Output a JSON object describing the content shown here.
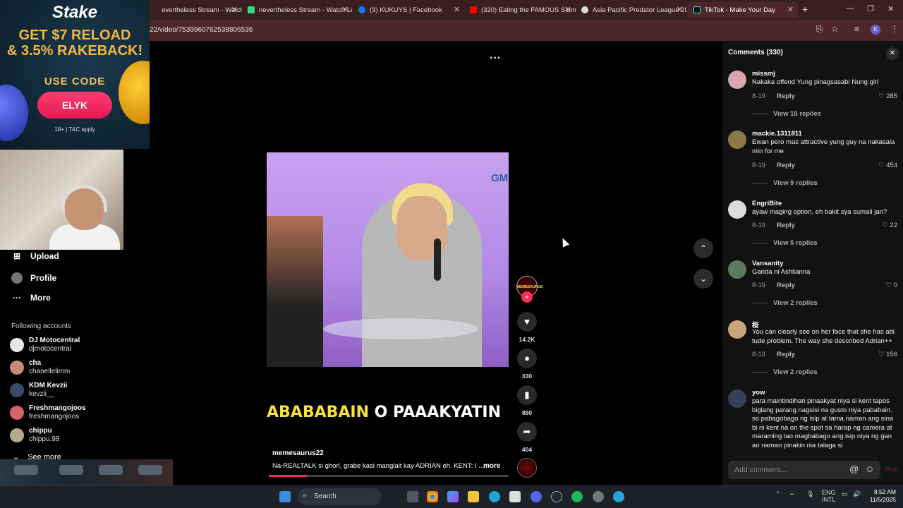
{
  "browser": {
    "tabs": [
      {
        "title": "evertheless Stream - Watch Li",
        "color": "#e53935"
      },
      {
        "title": "nevertheless Stream - Watch Li",
        "color": "#3ddc84"
      },
      {
        "title": "(3) KUKUYS | Facebook",
        "color": "#1877f2"
      },
      {
        "title": "(320) Eating the FAMOUS Slum",
        "color": "#ff0000"
      },
      {
        "title": "Asia Pacific Predator League 20",
        "color": "#ffffff"
      },
      {
        "title": "TikTok - Make Your Day",
        "color": "#000000"
      }
    ],
    "url": "22/video/7539960762538806536"
  },
  "ad": {
    "logo": "Stake",
    "line1": "GET $7 RELOAD",
    "line2": "& 3.5% RAKEBACK!",
    "code_label": "USE CODE",
    "code": "ELYK",
    "terms": "18+ | T&C apply"
  },
  "nav": {
    "upload": "Upload",
    "profile": "Profile",
    "more": "More",
    "following_title": "Following accounts",
    "accounts": [
      {
        "name": "DJ Motocentral",
        "handle": "djmotocentral"
      },
      {
        "name": "cha",
        "handle": "chanellelimm"
      },
      {
        "name": "KDM Kevzii",
        "handle": "kevzii__"
      },
      {
        "name": "Freshmangojoos",
        "handle": "freshmangojoos"
      },
      {
        "name": "chippu",
        "handle": "chippu.98"
      }
    ],
    "see_more": "See more"
  },
  "video": {
    "channel_logo": "GM",
    "caption_yellow": "ABABABAIN",
    "caption_white": " O PAAAKYATIN",
    "author": "memesaurus22",
    "description": "Na-REALTALK si ghorl, grabe kasi manglait kay ADRIAN eh. KENT: I ...",
    "more": "more",
    "progress_fraction": 0.16,
    "avatar_text": "MEMESAURUS"
  },
  "actions": {
    "likes": "14.2K",
    "comments": "330",
    "saves": "880",
    "shares": "404"
  },
  "comments": {
    "header": "Comments (330)",
    "input_placeholder": "Add comment...",
    "post": "Post",
    "reply_label": "Reply",
    "items": [
      {
        "user": "missmj",
        "text": "Nakaka offend Yung pinagsasabi Nung girl",
        "date": "8-19",
        "likes": "285",
        "replies": "View 15 replies"
      },
      {
        "user": "mackie.1311811",
        "text": "Ewan pero mas attractive yung guy na nakasala min for me",
        "date": "8-19",
        "likes": "454",
        "replies": "View 9 replies"
      },
      {
        "user": "EngriBite",
        "text": "ayaw maging option, eh bakit sya sumali jan?",
        "date": "8-19",
        "likes": "22",
        "replies": "View 5 replies"
      },
      {
        "user": "Vansanity",
        "text": "Ganda ni Ashlianna",
        "date": "8-19",
        "likes": "0",
        "replies": "View 2 replies"
      },
      {
        "user": "桜",
        "text": "You can clearly see on her face that she has atti tude problem. The way she described Adrian++",
        "date": "8-19",
        "likes": "156",
        "replies": "View 2 replies"
      },
      {
        "user": "yow",
        "text": "para maintindihan pinaakyat niya si kent tapos biglang parang nagsisi na gusto niya pababain. so pabagobago ng isip at tama naman ang sina bi ni kent na on the spot sa harap ng camera at maraming tao magbabago ang isip niya ng gan ao naman pinakin nia talaga si",
        "date": "",
        "likes": "",
        "replies": ""
      }
    ]
  },
  "taskbar": {
    "search": "Search",
    "lang1": "ENG",
    "lang2": "INTL",
    "time": "8:52 AM",
    "date": "11/5/2025"
  }
}
